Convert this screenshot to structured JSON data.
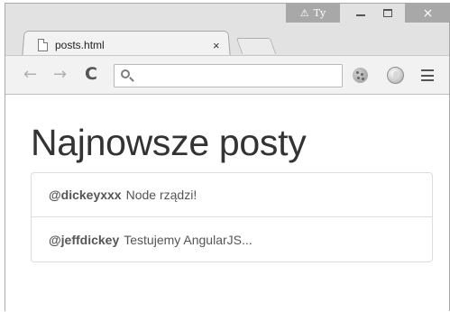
{
  "window": {
    "user_badge": "Ty",
    "close_glyph": "×"
  },
  "tab": {
    "title": "posts.html",
    "close_glyph": "×"
  },
  "toolbar": {
    "back_glyph": "←",
    "forward_glyph": "→",
    "reload_glyph": "C",
    "omnibox_value": "",
    "icons": [
      "back-arrow-icon",
      "forward-arrow-icon",
      "reload-icon",
      "search-icon",
      "cookie-extension-icon",
      "hand-extension-icon",
      "menu-icon"
    ]
  },
  "page": {
    "title": "Najnowsze posty",
    "posts": [
      {
        "username": "@dickeyxxx",
        "body": "Node rządzi!"
      },
      {
        "username": "@jeffdickey",
        "body": "Testujemy AngularJS..."
      }
    ]
  }
}
